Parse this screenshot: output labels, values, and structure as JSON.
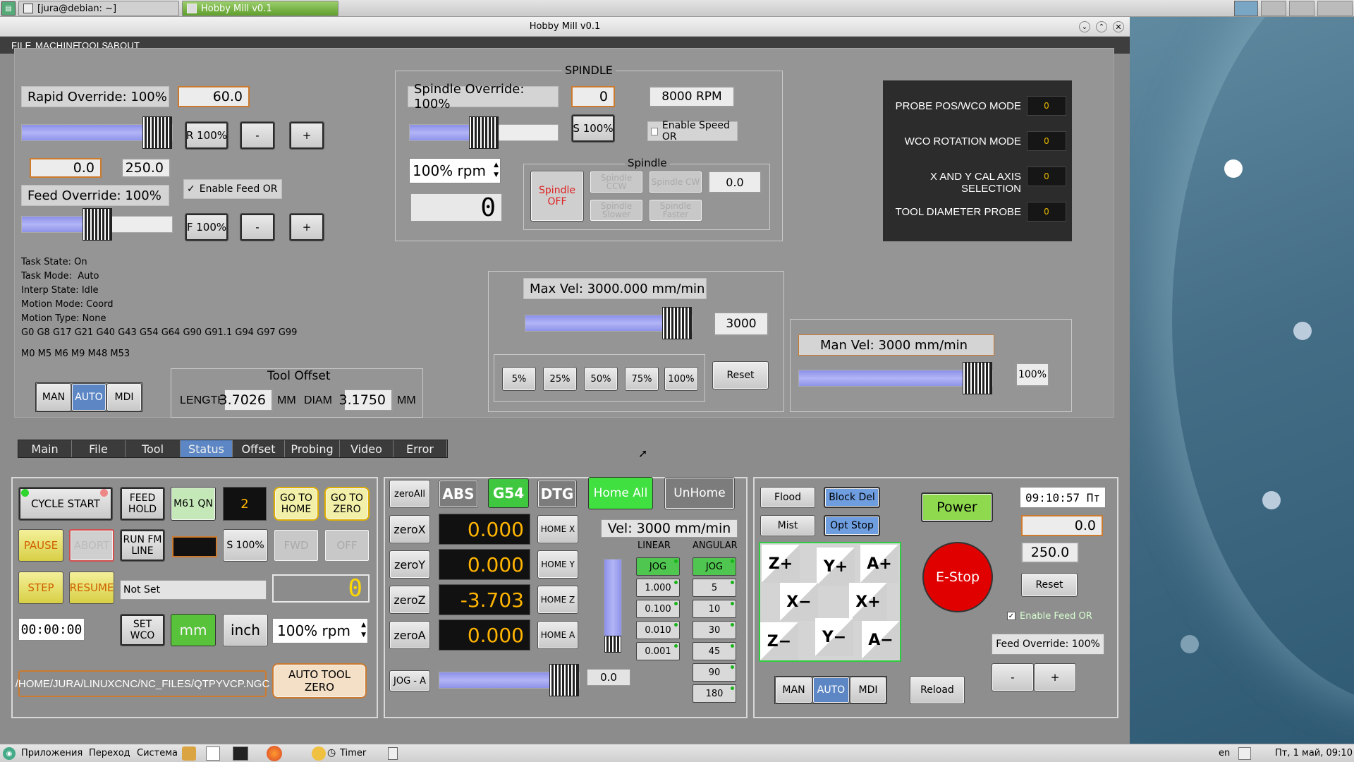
{
  "taskbar": {
    "terminal_task": "[jura@debian: ~]",
    "app_task": "Hobby Mill v0.1",
    "bottom_items": [
      "Приложения",
      "Переход",
      "Система"
    ],
    "timer_label": "Timer",
    "lang": "en",
    "clock": "Пт, 1 май, 09:10"
  },
  "window": {
    "title": "Hobby Mill v0.1"
  },
  "menu": [
    "FILE",
    "MACHINE",
    "TOOLS",
    "ABOUT"
  ],
  "rapid": {
    "label": "Rapid Override: 100%",
    "value": "60.0",
    "level": 1.0,
    "reset": "R 100%",
    "minus": "-",
    "plus": "+"
  },
  "feed": {
    "min_value": "0.0",
    "max_value": "250.0",
    "enable_label": "Enable Feed OR",
    "enable_checked": true,
    "label": "Feed Override: 100%",
    "level": 0.5,
    "reset": "F 100%",
    "minus": "-",
    "plus": "+"
  },
  "status_lines": [
    "Task State: On",
    "Task Mode:  Auto",
    "Interp State: Idle",
    "Motion Mode: Coord",
    "Motion Type: None",
    "G0 G8 G17 G21 G40 G43 G54 G64 G90 G91.1 G94 G97 G99",
    "M0 M5 M6 M9 M48 M53"
  ],
  "mode_buttons": [
    "MAN",
    "AUTO",
    "MDI"
  ],
  "active_mode": "AUTO",
  "tool_offset": {
    "title": "Tool Offset",
    "length_label": "LENGTH",
    "length": "3.7026",
    "length_unit": "MM",
    "diam_label": "DIAM",
    "diam": "3.1750",
    "diam_unit": "MM"
  },
  "spindle": {
    "title": "SPINDLE",
    "override_label": "Spindle Override: 100%",
    "override_value": "0",
    "rpm": "8000 RPM",
    "level": 0.5,
    "reset": "S 100%",
    "enable_speed_label": "Enable Speed OR",
    "spin_value": "100% rpm",
    "lcd": "0",
    "sub_title": "Spindle",
    "off": "Spindle OFF",
    "ccw": "Spindle CCW",
    "cw": "Spindle CW",
    "slower": "Spindle Slower",
    "faster": "Spindle Faster",
    "speed": "0.0"
  },
  "maxvel": {
    "label": "Max Vel: 3000.000 mm/min",
    "value": "3000",
    "level": 1.0,
    "presets": [
      "5%",
      "25%",
      "50%",
      "75%",
      "100%"
    ],
    "reset": "Reset"
  },
  "manvel": {
    "label": "Man Vel: 3000 mm/min",
    "level": 1.0,
    "value": "100%"
  },
  "probe": [
    {
      "label": "PROBE POS/WCO MODE",
      "value": "0"
    },
    {
      "label": "WCO ROTATION MODE",
      "value": "0"
    },
    {
      "label": "X AND Y CAL AXIS SELECTION",
      "value": "0"
    },
    {
      "label": "TOOL DIAMETER PROBE",
      "value": "0"
    }
  ],
  "tabs": [
    "Main",
    "File",
    "Tool",
    "Status",
    "Offset",
    "Probing",
    "Video",
    "Error"
  ],
  "active_tab": "Status",
  "run": {
    "cycle_start": "CYCLE START",
    "feed_hold": "FEED HOLD",
    "m61": "M61 QN",
    "tool_num": "2",
    "go_home": "GO TO HOME",
    "go_zero": "GO TO ZERO",
    "pause": "PAUSE",
    "abort": "ABORT",
    "run_from_line": "RUN FM LINE",
    "s100": "S 100%",
    "fwd": "FWD",
    "off": "OFF",
    "step": "STEP",
    "resume": "RESUME",
    "not_set": "Not Set",
    "lcd": "0",
    "timer": "00:00:00",
    "set_wco": "SET WCO",
    "mm": "mm",
    "inch": "inch",
    "rpm": "100% rpm",
    "file_path": "/HOME/JURA/LINUXCNC/NC_FILES/QTPYVCP.NGC",
    "auto_tool_zero": "AUTO TOOL ZERO"
  },
  "dro": {
    "zero_all": "zeroAll",
    "abs": "ABS",
    "g54": "G54",
    "dtg": "DTG",
    "home_all": "Home All",
    "unhome": "UnHome",
    "axes": [
      {
        "zero": "zeroX",
        "value": "0.000",
        "home": "HOME X"
      },
      {
        "zero": "zeroY",
        "value": "0.000",
        "home": "HOME Y"
      },
      {
        "zero": "zeroZ",
        "value": "-3.703",
        "home": "HOME Z"
      },
      {
        "zero": "zeroA",
        "value": "0.000",
        "home": "HOME A"
      }
    ],
    "vel": "Vel: 3000 mm/min",
    "jog_a": "JOG - A",
    "jog_a_value": "0.0",
    "jog_a_level": 1.0,
    "linear_label": "LINEAR",
    "angular_label": "ANGULAR",
    "linear": [
      "JOG",
      "1.000",
      "0.100",
      "0.010",
      "0.001"
    ],
    "angular": [
      "JOG",
      "5",
      "10",
      "30",
      "45",
      "90",
      "180"
    ]
  },
  "right": {
    "flood": "Flood",
    "block_del": "Block Del",
    "mist": "Mist",
    "opt_stop": "Opt Stop",
    "power": "Power",
    "estop": "E-Stop",
    "time": "09:10:57 Пт",
    "feed_min": "0.0",
    "feed_max": "250.0",
    "reset": "Reset",
    "enable_feed": "Enable Feed OR",
    "feed_override": "Feed Override: 100%",
    "minus": "-",
    "plus": "+",
    "reload": "Reload",
    "jog": [
      "Z+",
      "Y+",
      "A+",
      "X−",
      "X+",
      "Z−",
      "Y−",
      "A−"
    ]
  }
}
